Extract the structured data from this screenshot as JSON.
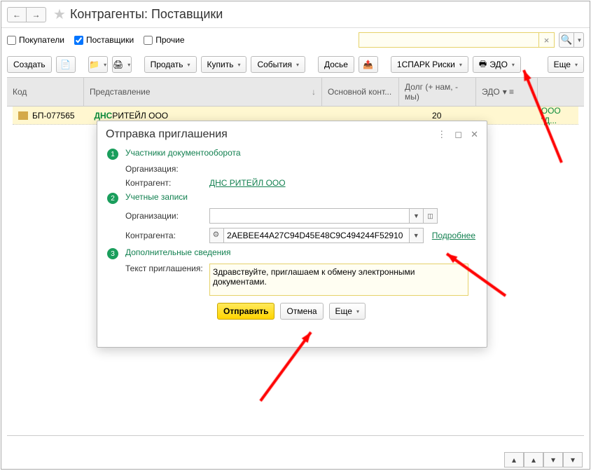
{
  "header": {
    "title": "Контрагенты: Поставщики"
  },
  "filters": {
    "buyers": "Покупатели",
    "suppliers": "Поставщики",
    "others": "Прочие",
    "search_placeholder": ""
  },
  "toolbar": {
    "create": "Создать",
    "sell": "Продать",
    "buy": "Купить",
    "events": "События",
    "dossier": "Досье",
    "spark": "1СПАРК Риски",
    "edo": "ЭДО",
    "more": "Еще"
  },
  "table": {
    "headers": {
      "code": "Код",
      "name": "Представление",
      "main_cont": "Основной конт...",
      "debt": "Долг (+ нам, - мы)",
      "edo": "ЭДО"
    },
    "row": {
      "code": "БП-077565",
      "name_green": "ДНС",
      "name_rest": " РИТЕЙЛ ООО",
      "debt": "20",
      "extra": "ООО \"Д..."
    }
  },
  "dialog": {
    "title": "Отправка приглашения",
    "sections": {
      "s1": "Участники документооборота",
      "s2": "Учетные записи",
      "s3": "Дополнительные сведения"
    },
    "labels": {
      "org": "Организация:",
      "counterparty": "Контрагент:",
      "org_accounts": "Организации:",
      "counterparty_accounts": "Контрагента:",
      "invite_text": "Текст приглашения:"
    },
    "values": {
      "counterparty_link": "ДНС РИТЕЙЛ ООО",
      "account_id": "2AEBEE44A27C94D45E48C9C494244F52910",
      "more_link": "Подробнее",
      "invite_message": "Здравствуйте, приглашаем к обмену электронными документами."
    },
    "buttons": {
      "send": "Отправить",
      "cancel": "Отмена",
      "more": "Еще"
    },
    "steps": {
      "n1": "1",
      "n2": "2",
      "n3": "3"
    }
  }
}
